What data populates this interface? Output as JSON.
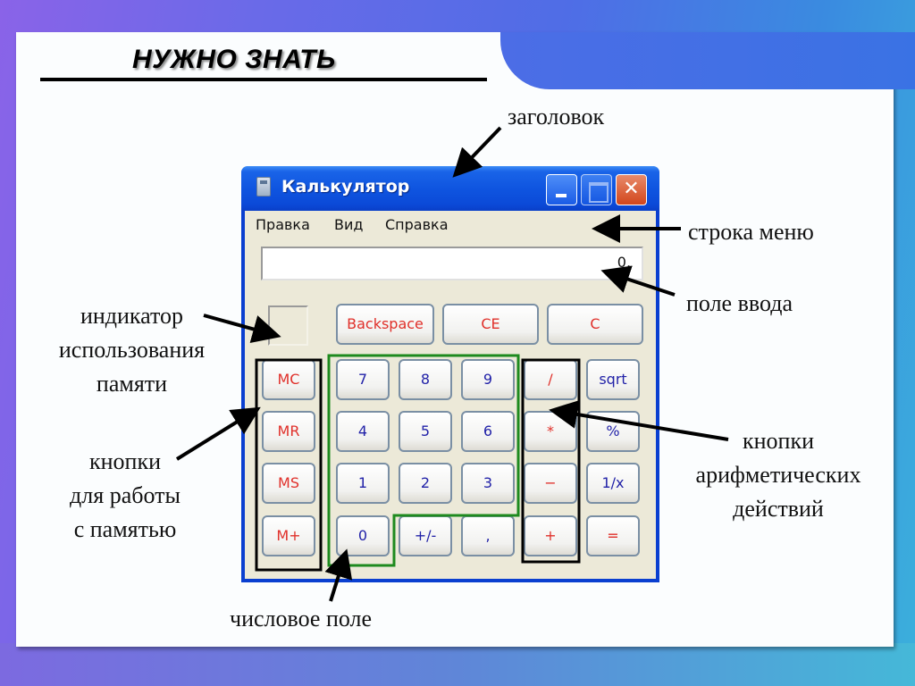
{
  "slide": {
    "title": "НУЖНО ЗНАТЬ",
    "labels": {
      "titlebar": "заголовок",
      "menubar": "строка меню",
      "input_field": "поле ввода",
      "memory_indicator": [
        "индикатор",
        "использования",
        "памяти"
      ],
      "memory_buttons": [
        "кнопки",
        "для работы",
        "с памятью"
      ],
      "arithmetic_buttons": [
        "кнопки",
        "арифметических",
        "действий"
      ],
      "numeric_field": "числовое поле"
    }
  },
  "calculator": {
    "title": "Калькулятор",
    "icon": "calculator-icon",
    "window_buttons": {
      "minimize": "minimize-icon",
      "maximize": "maximize-icon",
      "close": "✕"
    },
    "menu": [
      "Правка",
      "Вид",
      "Справка"
    ],
    "display_value": "0,",
    "top_keys": [
      "Backspace",
      "CE",
      "C"
    ],
    "memory_keys": [
      "MC",
      "MR",
      "MS",
      "M+"
    ],
    "digit_rows": [
      [
        "7",
        "8",
        "9"
      ],
      [
        "4",
        "5",
        "6"
      ],
      [
        "1",
        "2",
        "3"
      ],
      [
        "0",
        "+/-",
        ","
      ]
    ],
    "operator_keys": [
      "/",
      "*",
      "−",
      "+"
    ],
    "function_keys": [
      "sqrt",
      "%",
      "1/x",
      "="
    ],
    "colors": {
      "title_bar": "#0f55e0",
      "client": "#ece9d8",
      "red_label": "#e0302a",
      "blue_label": "#2222a8",
      "numeric_outline": "#1e8a1e",
      "group_outline": "#000000"
    }
  }
}
